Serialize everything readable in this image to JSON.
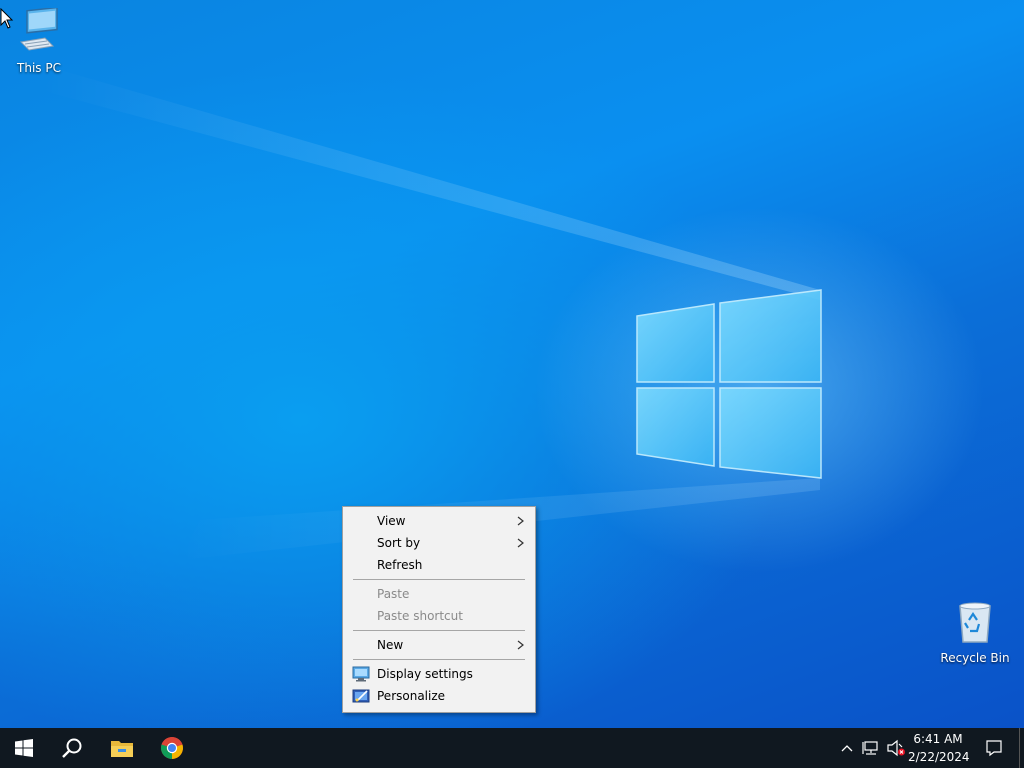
{
  "desktop": {
    "icons": [
      {
        "label": "This PC",
        "icon": "computer-icon"
      },
      {
        "label": "Recycle Bin",
        "icon": "recycle-bin-icon"
      }
    ]
  },
  "context_menu": {
    "items": [
      {
        "label": "View",
        "submenu": true,
        "enabled": true
      },
      {
        "label": "Sort by",
        "submenu": true,
        "enabled": true
      },
      {
        "label": "Refresh",
        "submenu": false,
        "enabled": true
      },
      {
        "label": "Paste",
        "submenu": false,
        "enabled": false
      },
      {
        "label": "Paste shortcut",
        "submenu": false,
        "enabled": false
      },
      {
        "label": "New",
        "submenu": true,
        "enabled": true
      },
      {
        "label": "Display settings",
        "icon": "display-icon",
        "enabled": true
      },
      {
        "label": "Personalize",
        "icon": "personalize-icon",
        "enabled": true
      }
    ]
  },
  "taskbar": {
    "pinned": [
      "windows-start-icon",
      "search-icon",
      "file-explorer-icon",
      "chrome-icon"
    ],
    "tray": {
      "time": "6:41 AM",
      "date": "2/22/2024",
      "icons": [
        "chevron-up-icon",
        "network-icon",
        "volume-muted-icon",
        "notification-icon"
      ]
    }
  },
  "colors": {
    "taskbar_bg": "#101820",
    "menu_bg": "#f2f2f2",
    "desktop_accent": "#0a84e0"
  }
}
